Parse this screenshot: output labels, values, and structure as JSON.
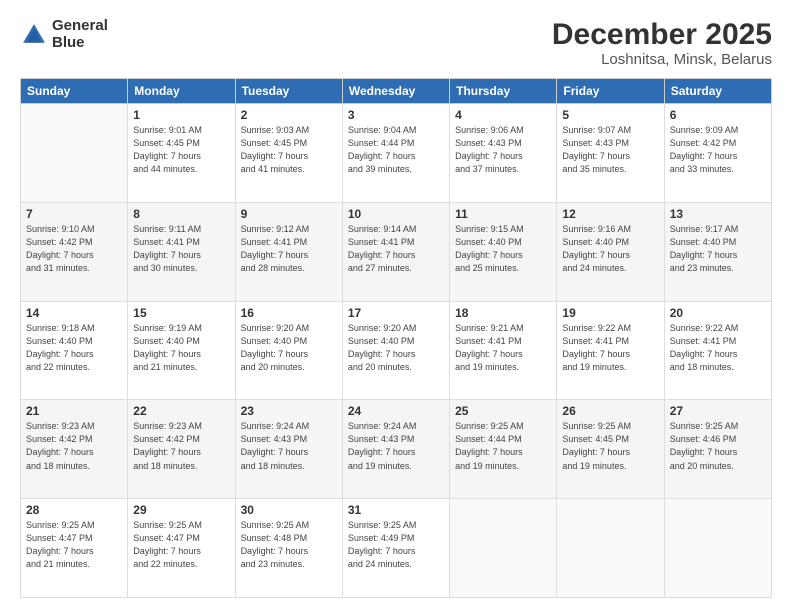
{
  "header": {
    "logo_line1": "General",
    "logo_line2": "Blue",
    "title": "December 2025",
    "subtitle": "Loshnitsa, Minsk, Belarus"
  },
  "calendar": {
    "headers": [
      "Sunday",
      "Monday",
      "Tuesday",
      "Wednesday",
      "Thursday",
      "Friday",
      "Saturday"
    ],
    "weeks": [
      [
        {
          "day": "",
          "info": ""
        },
        {
          "day": "1",
          "info": "Sunrise: 9:01 AM\nSunset: 4:45 PM\nDaylight: 7 hours\nand 44 minutes."
        },
        {
          "day": "2",
          "info": "Sunrise: 9:03 AM\nSunset: 4:45 PM\nDaylight: 7 hours\nand 41 minutes."
        },
        {
          "day": "3",
          "info": "Sunrise: 9:04 AM\nSunset: 4:44 PM\nDaylight: 7 hours\nand 39 minutes."
        },
        {
          "day": "4",
          "info": "Sunrise: 9:06 AM\nSunset: 4:43 PM\nDaylight: 7 hours\nand 37 minutes."
        },
        {
          "day": "5",
          "info": "Sunrise: 9:07 AM\nSunset: 4:43 PM\nDaylight: 7 hours\nand 35 minutes."
        },
        {
          "day": "6",
          "info": "Sunrise: 9:09 AM\nSunset: 4:42 PM\nDaylight: 7 hours\nand 33 minutes."
        }
      ],
      [
        {
          "day": "7",
          "info": "Sunrise: 9:10 AM\nSunset: 4:42 PM\nDaylight: 7 hours\nand 31 minutes."
        },
        {
          "day": "8",
          "info": "Sunrise: 9:11 AM\nSunset: 4:41 PM\nDaylight: 7 hours\nand 30 minutes."
        },
        {
          "day": "9",
          "info": "Sunrise: 9:12 AM\nSunset: 4:41 PM\nDaylight: 7 hours\nand 28 minutes."
        },
        {
          "day": "10",
          "info": "Sunrise: 9:14 AM\nSunset: 4:41 PM\nDaylight: 7 hours\nand 27 minutes."
        },
        {
          "day": "11",
          "info": "Sunrise: 9:15 AM\nSunset: 4:40 PM\nDaylight: 7 hours\nand 25 minutes."
        },
        {
          "day": "12",
          "info": "Sunrise: 9:16 AM\nSunset: 4:40 PM\nDaylight: 7 hours\nand 24 minutes."
        },
        {
          "day": "13",
          "info": "Sunrise: 9:17 AM\nSunset: 4:40 PM\nDaylight: 7 hours\nand 23 minutes."
        }
      ],
      [
        {
          "day": "14",
          "info": "Sunrise: 9:18 AM\nSunset: 4:40 PM\nDaylight: 7 hours\nand 22 minutes."
        },
        {
          "day": "15",
          "info": "Sunrise: 9:19 AM\nSunset: 4:40 PM\nDaylight: 7 hours\nand 21 minutes."
        },
        {
          "day": "16",
          "info": "Sunrise: 9:20 AM\nSunset: 4:40 PM\nDaylight: 7 hours\nand 20 minutes."
        },
        {
          "day": "17",
          "info": "Sunrise: 9:20 AM\nSunset: 4:40 PM\nDaylight: 7 hours\nand 20 minutes."
        },
        {
          "day": "18",
          "info": "Sunrise: 9:21 AM\nSunset: 4:41 PM\nDaylight: 7 hours\nand 19 minutes."
        },
        {
          "day": "19",
          "info": "Sunrise: 9:22 AM\nSunset: 4:41 PM\nDaylight: 7 hours\nand 19 minutes."
        },
        {
          "day": "20",
          "info": "Sunrise: 9:22 AM\nSunset: 4:41 PM\nDaylight: 7 hours\nand 18 minutes."
        }
      ],
      [
        {
          "day": "21",
          "info": "Sunrise: 9:23 AM\nSunset: 4:42 PM\nDaylight: 7 hours\nand 18 minutes."
        },
        {
          "day": "22",
          "info": "Sunrise: 9:23 AM\nSunset: 4:42 PM\nDaylight: 7 hours\nand 18 minutes."
        },
        {
          "day": "23",
          "info": "Sunrise: 9:24 AM\nSunset: 4:43 PM\nDaylight: 7 hours\nand 18 minutes."
        },
        {
          "day": "24",
          "info": "Sunrise: 9:24 AM\nSunset: 4:43 PM\nDaylight: 7 hours\nand 19 minutes."
        },
        {
          "day": "25",
          "info": "Sunrise: 9:25 AM\nSunset: 4:44 PM\nDaylight: 7 hours\nand 19 minutes."
        },
        {
          "day": "26",
          "info": "Sunrise: 9:25 AM\nSunset: 4:45 PM\nDaylight: 7 hours\nand 19 minutes."
        },
        {
          "day": "27",
          "info": "Sunrise: 9:25 AM\nSunset: 4:46 PM\nDaylight: 7 hours\nand 20 minutes."
        }
      ],
      [
        {
          "day": "28",
          "info": "Sunrise: 9:25 AM\nSunset: 4:47 PM\nDaylight: 7 hours\nand 21 minutes."
        },
        {
          "day": "29",
          "info": "Sunrise: 9:25 AM\nSunset: 4:47 PM\nDaylight: 7 hours\nand 22 minutes."
        },
        {
          "day": "30",
          "info": "Sunrise: 9:25 AM\nSunset: 4:48 PM\nDaylight: 7 hours\nand 23 minutes."
        },
        {
          "day": "31",
          "info": "Sunrise: 9:25 AM\nSunset: 4:49 PM\nDaylight: 7 hours\nand 24 minutes."
        },
        {
          "day": "",
          "info": ""
        },
        {
          "day": "",
          "info": ""
        },
        {
          "day": "",
          "info": ""
        }
      ]
    ]
  }
}
